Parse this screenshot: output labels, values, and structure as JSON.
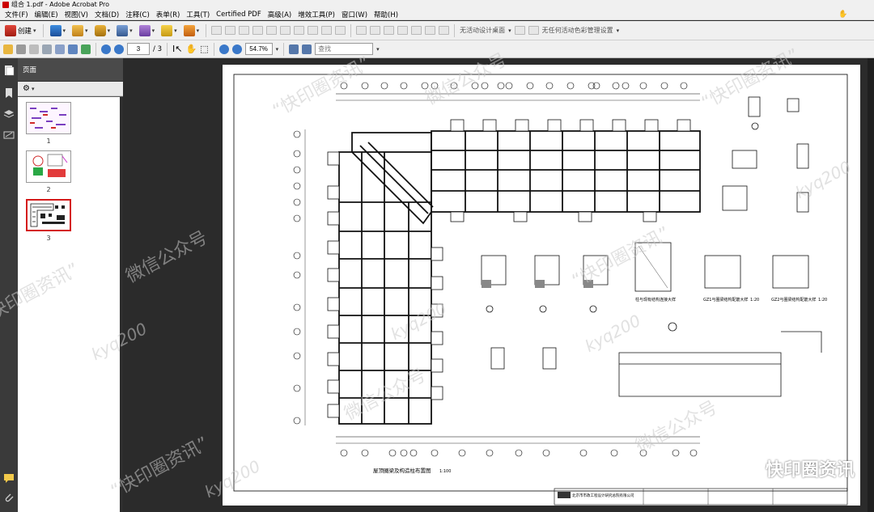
{
  "window": {
    "title": "组合 1.pdf - Adobe Acrobat Pro"
  },
  "menu": [
    "文件(F)",
    "编辑(E)",
    "视图(V)",
    "文档(D)",
    "注释(C)",
    "表单(R)",
    "工具(T)",
    "Certified PDF",
    "高级(A)",
    "增效工具(P)",
    "窗口(W)",
    "帮助(H)"
  ],
  "toolbar1": {
    "create_label": "创建",
    "design_view_label": "无活动设计桌面",
    "color_mgmt_label": "无任何活动色彩管理设置"
  },
  "toolbar2": {
    "page_current": "3",
    "page_total": "/ 3",
    "zoom": "54.7%",
    "find_placeholder": "查找"
  },
  "pages_panel": {
    "title": "页面",
    "thumbnails": [
      {
        "label": "1",
        "selected": false
      },
      {
        "label": "2",
        "selected": false
      },
      {
        "label": "3",
        "selected": true
      }
    ]
  },
  "drawing": {
    "main_title": "屋顶圈梁及构造柱布置图",
    "main_scale": "1:100",
    "detail_a": "GZ1与圈梁结构配筋大样",
    "detail_a_scale": "1:20",
    "detail_b": "GZ2与圈梁结构配筋大样",
    "detail_b_scale": "1:20",
    "detail_c": "柱与现有结构连接大样",
    "company": "北京市市政工程设计研究总院有限公司"
  },
  "watermarks": {
    "cn1": "“快印圈资讯”",
    "cn2": "微信公众号",
    "en": "kyq200",
    "brand": "快印圈资讯"
  }
}
